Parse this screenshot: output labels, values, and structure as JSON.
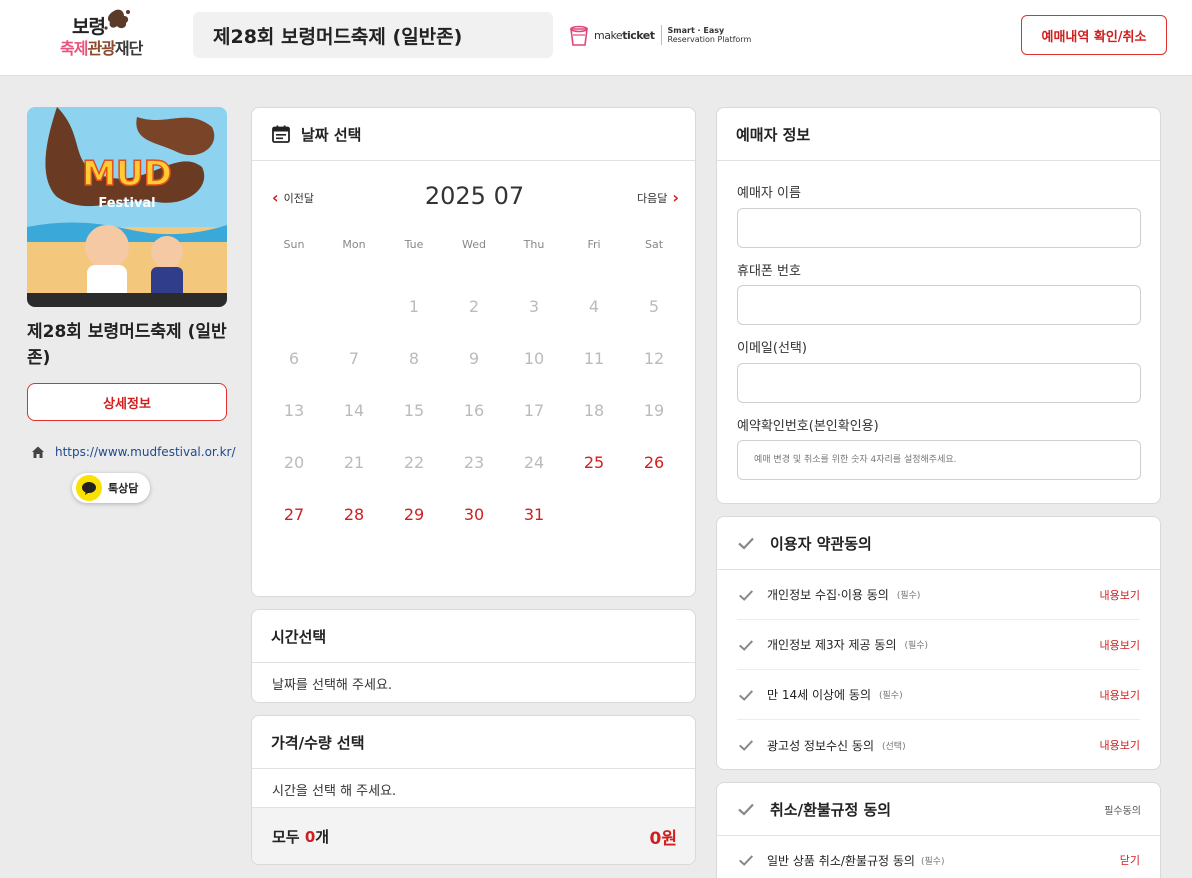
{
  "header": {
    "logo_line1": "보령",
    "logo_line2_a": "축제",
    "logo_line2_b": "관광",
    "logo_line2_c": "재단",
    "event_title": "제28회 보령머드축제 (일반존)",
    "brand_make": "make",
    "brand_ticket": "ticket",
    "brand_tag1": "Smart · Easy",
    "brand_tag2": "Reservation Platform",
    "reservation_button": "예매내역 확인/취소"
  },
  "left": {
    "poster_title": "제28회 보령머드축제 (일반존)",
    "detail_button": "상세정보",
    "homepage_url": "https://www.mudfestival.or.kr/",
    "talk_button": "톡상담"
  },
  "calendar": {
    "title": "날짜 선택",
    "prev_label": "이전달",
    "next_label": "다음달",
    "month_label": "2025 07",
    "weekdays": [
      "Sun",
      "Mon",
      "Tue",
      "Wed",
      "Thu",
      "Fri",
      "Sat"
    ],
    "weeks": [
      [
        {
          "d": ""
        },
        {
          "d": ""
        },
        {
          "d": "1"
        },
        {
          "d": "2"
        },
        {
          "d": "3"
        },
        {
          "d": "4"
        },
        {
          "d": "5"
        }
      ],
      [
        {
          "d": "6"
        },
        {
          "d": "7"
        },
        {
          "d": "8"
        },
        {
          "d": "9"
        },
        {
          "d": "10"
        },
        {
          "d": "11"
        },
        {
          "d": "12"
        }
      ],
      [
        {
          "d": "13"
        },
        {
          "d": "14"
        },
        {
          "d": "15"
        },
        {
          "d": "16"
        },
        {
          "d": "17"
        },
        {
          "d": "18"
        },
        {
          "d": "19"
        }
      ],
      [
        {
          "d": "20"
        },
        {
          "d": "21"
        },
        {
          "d": "22"
        },
        {
          "d": "23"
        },
        {
          "d": "24"
        },
        {
          "d": "25",
          "on": true
        },
        {
          "d": "26",
          "on": true
        }
      ],
      [
        {
          "d": "27",
          "on": true
        },
        {
          "d": "28",
          "on": true
        },
        {
          "d": "29",
          "on": true
        },
        {
          "d": "30",
          "on": true
        },
        {
          "d": "31",
          "on": true
        },
        {
          "d": ""
        },
        {
          "d": ""
        }
      ]
    ]
  },
  "time": {
    "title": "시간선택",
    "message": "날짜를 선택해 주세요."
  },
  "price": {
    "title": "가격/수량 선택",
    "message": "시간을 선택 해 주세요.",
    "total_label": "모두 ",
    "total_count": "0",
    "total_unit": "개",
    "total_amount": "0원"
  },
  "booker": {
    "title": "예매자 정보",
    "name_label": "예매자 이름",
    "phone_label": "휴대폰 번호",
    "email_label": "이메일(선택)",
    "pin_label": "예약확인번호(본인확인용)",
    "pin_placeholder": "예매 변경 및 취소를 위한 숫자 4자리를 설정해주세요."
  },
  "terms": {
    "title": "이용자 약관동의",
    "items": [
      {
        "label": "개인정보 수집·이용 동의",
        "req": "(필수)",
        "view": "내용보기"
      },
      {
        "label": "개인정보 제3자 제공 동의",
        "req": "(필수)",
        "view": "내용보기"
      },
      {
        "label": "만 14세 이상에 동의",
        "req": "(필수)",
        "view": "내용보기"
      },
      {
        "label": "광고성 정보수신 동의",
        "req": "(선택)",
        "view": "내용보기"
      }
    ]
  },
  "refund": {
    "title": "취소/환불규정 동의",
    "badge": "필수동의",
    "row_label": "일반 상품 취소/환불규정 동의",
    "row_req": "(필수)",
    "row_action": "닫기"
  },
  "colors": {
    "accent_red": "#d11f1f",
    "link_blue": "#1e4a8e",
    "kakao_yellow": "#fae100"
  }
}
